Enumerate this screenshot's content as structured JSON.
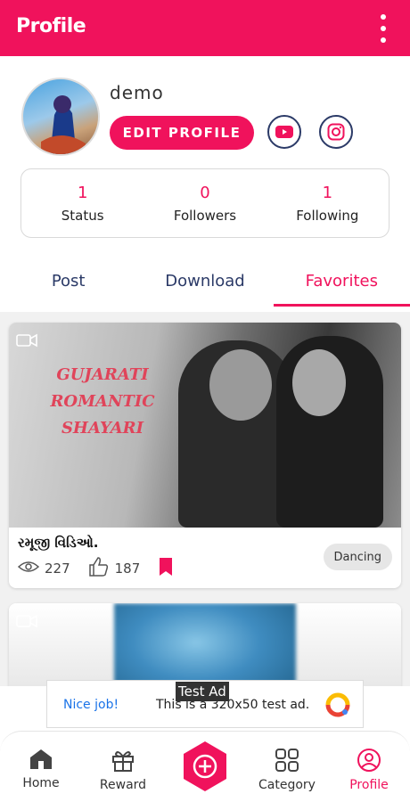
{
  "appbar": {
    "title": "Profile"
  },
  "profile": {
    "username": "demo",
    "edit_label": "EDIT PROFILE",
    "stats": [
      {
        "value": "1",
        "label": "Status"
      },
      {
        "value": "0",
        "label": "Followers"
      },
      {
        "value": "1",
        "label": "Following"
      }
    ]
  },
  "tabs": [
    {
      "label": "Post",
      "active": false
    },
    {
      "label": "Download",
      "active": false
    },
    {
      "label": "Favorites",
      "active": true
    }
  ],
  "feed": [
    {
      "thumb_text": "GUJARATI ROMANTIC SHAYARI",
      "title": "રમૂજી વિડિઓ.",
      "views": "227",
      "likes": "187",
      "category": "Dancing"
    }
  ],
  "ad": {
    "label": "Test Ad",
    "nice": "Nice job!",
    "text": "This is a 320x50 test ad."
  },
  "bottom_nav": {
    "home": "Home",
    "reward": "Reward",
    "category": "Category",
    "profile": "Profile"
  },
  "colors": {
    "accent": "#f0125c",
    "nav_dark": "#2b3a67"
  }
}
